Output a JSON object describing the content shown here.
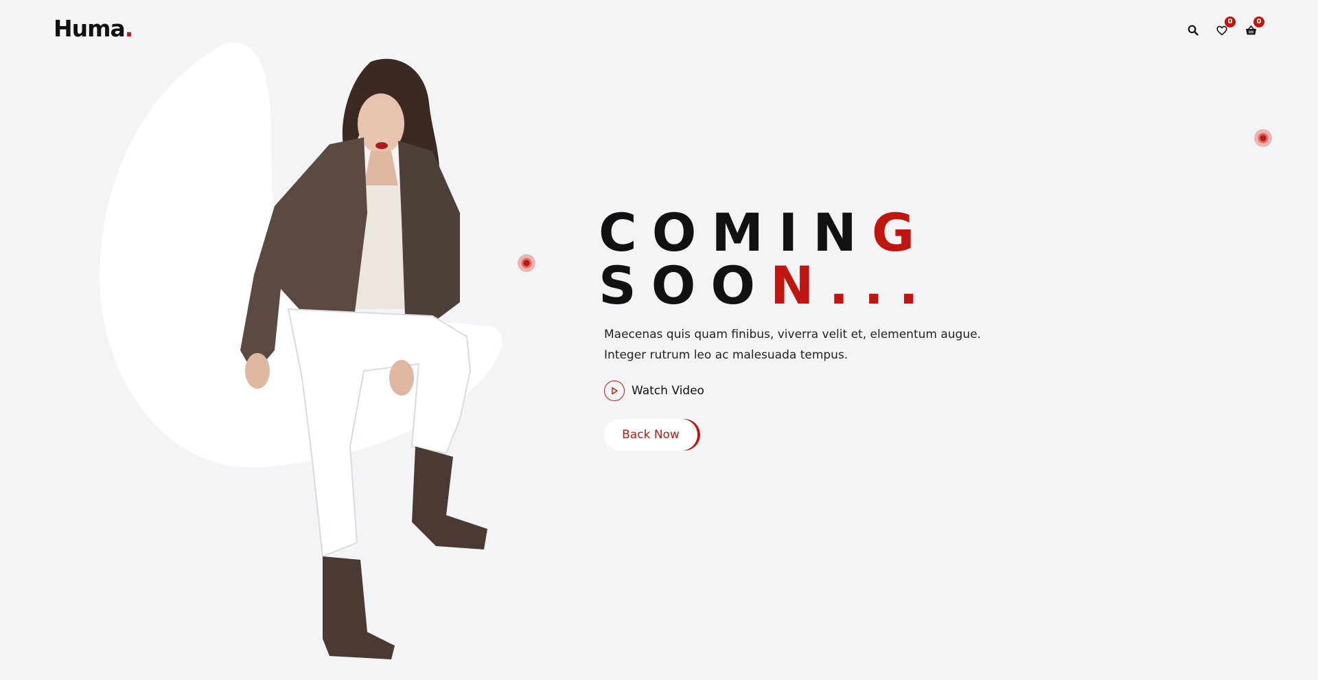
{
  "header": {
    "logo_text": "Huma",
    "logo_accent": ".",
    "search_icon": "search-icon",
    "wishlist_icon": "heart-icon",
    "wishlist_count": "0",
    "cart_icon": "basket-icon",
    "cart_count": "0"
  },
  "hero": {
    "line1_main": "COMIN",
    "line1_accent": "G",
    "line2_main": "SOO",
    "line2_accent": "N...",
    "description": "Maecenas quis quam finibus, viverra velit et, elementum augue. Integer rutrum leo ac malesuada tempus.",
    "watch_label": "Watch Video",
    "watch_icon": "play-icon",
    "button_label": "Back Now"
  },
  "colors": {
    "accent": "#c0160f",
    "background": "#f3f4f6",
    "text": "#111111"
  }
}
